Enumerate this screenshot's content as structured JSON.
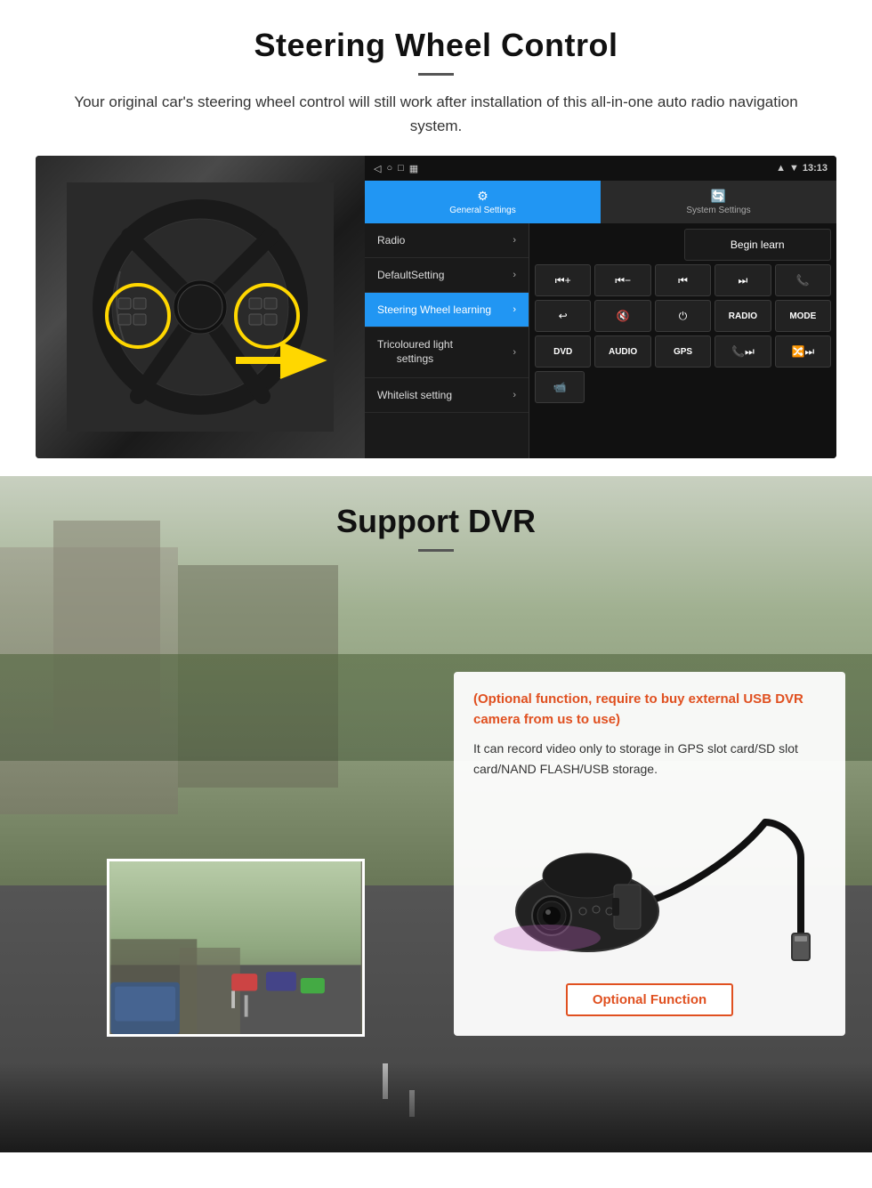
{
  "steering": {
    "title": "Steering Wheel Control",
    "subtitle": "Your original car's steering wheel control will still work after installation of this all-in-one auto radio navigation system.",
    "statusbar": {
      "time": "13:13",
      "signal": "▼",
      "wifi": "▼"
    },
    "tabs": {
      "general": "General Settings",
      "system": "System Settings"
    },
    "menu": {
      "items": [
        {
          "label": "Radio",
          "active": false
        },
        {
          "label": "DefaultSetting",
          "active": false
        },
        {
          "label": "Steering Wheel learning",
          "active": true
        },
        {
          "label": "Tricoloured light settings",
          "active": false
        },
        {
          "label": "Whitelist setting",
          "active": false
        }
      ]
    },
    "controls": {
      "begin_learn": "Begin learn",
      "buttons": [
        [
          "⏮+",
          "⏮−",
          "⏭|",
          "⏭⏭",
          "📞"
        ],
        [
          "↩",
          "🔇×",
          "⏻",
          "RADIO",
          "MODE"
        ],
        [
          "DVD",
          "AUDIO",
          "GPS",
          "📞⏭",
          "🔀⏭"
        ]
      ]
    }
  },
  "dvr": {
    "title": "Support DVR",
    "optional_highlight": "(Optional function, require to buy external USB DVR camera from us to use)",
    "description": "It can record video only to storage in GPS slot card/SD slot card/NAND FLASH/USB storage.",
    "optional_function_btn": "Optional Function"
  }
}
